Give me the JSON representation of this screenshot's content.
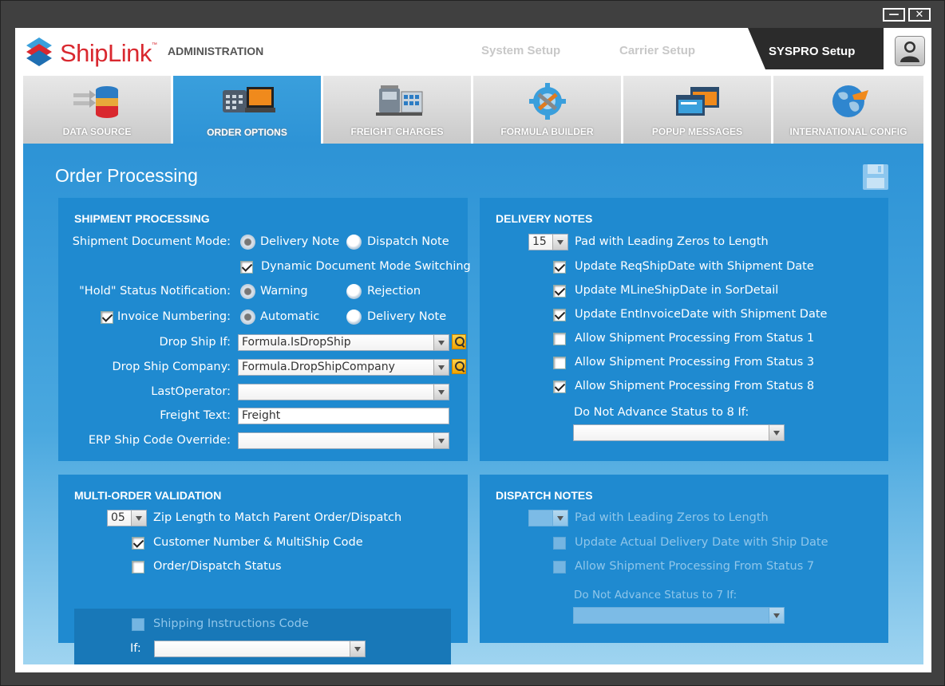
{
  "window": {
    "minimize_label": "—",
    "close_label": "✕"
  },
  "header": {
    "brand": "ShipLink",
    "brand_tm": "™",
    "section": "ADMINISTRATION",
    "top_tabs": [
      "System Setup",
      "Carrier Setup",
      "SYSPRO Setup"
    ],
    "active_top_tab": "SYSPRO Setup"
  },
  "nav_tabs": [
    {
      "label": "DATA SOURCE",
      "icon": "database-icon"
    },
    {
      "label": "ORDER OPTIONS",
      "icon": "phone-terminal-icon",
      "active": true
    },
    {
      "label": "FREIGHT CHARGES",
      "icon": "truck-icon"
    },
    {
      "label": "FORMULA BUILDER",
      "icon": "gear-tools-icon"
    },
    {
      "label": "POPUP MESSAGES",
      "icon": "windows-icon"
    },
    {
      "label": "INTERNATIONAL CONFIG",
      "icon": "globe-icon"
    }
  ],
  "page": {
    "title": "Order Processing",
    "save_icon": "save-icon"
  },
  "shipment": {
    "title": "SHIPMENT PROCESSING",
    "doc_mode_label": "Shipment Document Mode:",
    "doc_mode_opt1": "Delivery Note",
    "doc_mode_opt2": "Dispatch Note",
    "dynamic_label": "Dynamic Document Mode Switching",
    "hold_label": "\"Hold\" Status Notification:",
    "hold_opt1": "Warning",
    "hold_opt2": "Rejection",
    "invoice_label": "Invoice Numbering:",
    "invoice_opt1": "Automatic",
    "invoice_opt2": "Delivery Note",
    "dropship_label": "Drop Ship If:",
    "dropship_value": "Formula.IsDropShip",
    "dropship_company_label": "Drop Ship Company:",
    "dropship_company_value": "Formula.DropShipCompany",
    "lastop_label": "LastOperator:",
    "lastop_value": "",
    "freight_label": "Freight Text:",
    "freight_value": "Freight",
    "erp_label": "ERP Ship Code Override:",
    "erp_value": ""
  },
  "delivery": {
    "title": "DELIVERY NOTES",
    "pad_value": "15",
    "pad_label": "Pad with Leading Zeros to Length",
    "opt_reqship": "Update ReqShipDate with Shipment Date",
    "opt_mline": "Update MLineShipDate in SorDetail",
    "opt_entinv": "Update EntInvoiceDate with Shipment Date",
    "opt_status1": "Allow Shipment Processing From Status 1",
    "opt_status3": "Allow Shipment Processing From Status 3",
    "opt_status8": "Allow Shipment Processing From Status 8",
    "advance_label": "Do Not Advance Status to 8 If:",
    "advance_value": ""
  },
  "multi": {
    "title": "MULTI-ORDER VALIDATION",
    "zip_value": "05",
    "zip_label": "Zip Length to Match Parent Order/Dispatch",
    "opt_customer": "Customer Number & MultiShip Code",
    "opt_status": "Order/Dispatch Status",
    "opt_shipping": "Shipping Instructions Code",
    "if_label": "If:",
    "if_value": ""
  },
  "dispatch": {
    "title": "DISPATCH NOTES",
    "pad_value": "",
    "pad_label": "Pad with Leading Zeros to Length",
    "opt_actual": "Update Actual Delivery Date with Ship Date",
    "opt_status7": "Allow Shipment Processing From Status 7",
    "advance_label": "Do Not Advance Status to 7 If:",
    "advance_value": ""
  }
}
